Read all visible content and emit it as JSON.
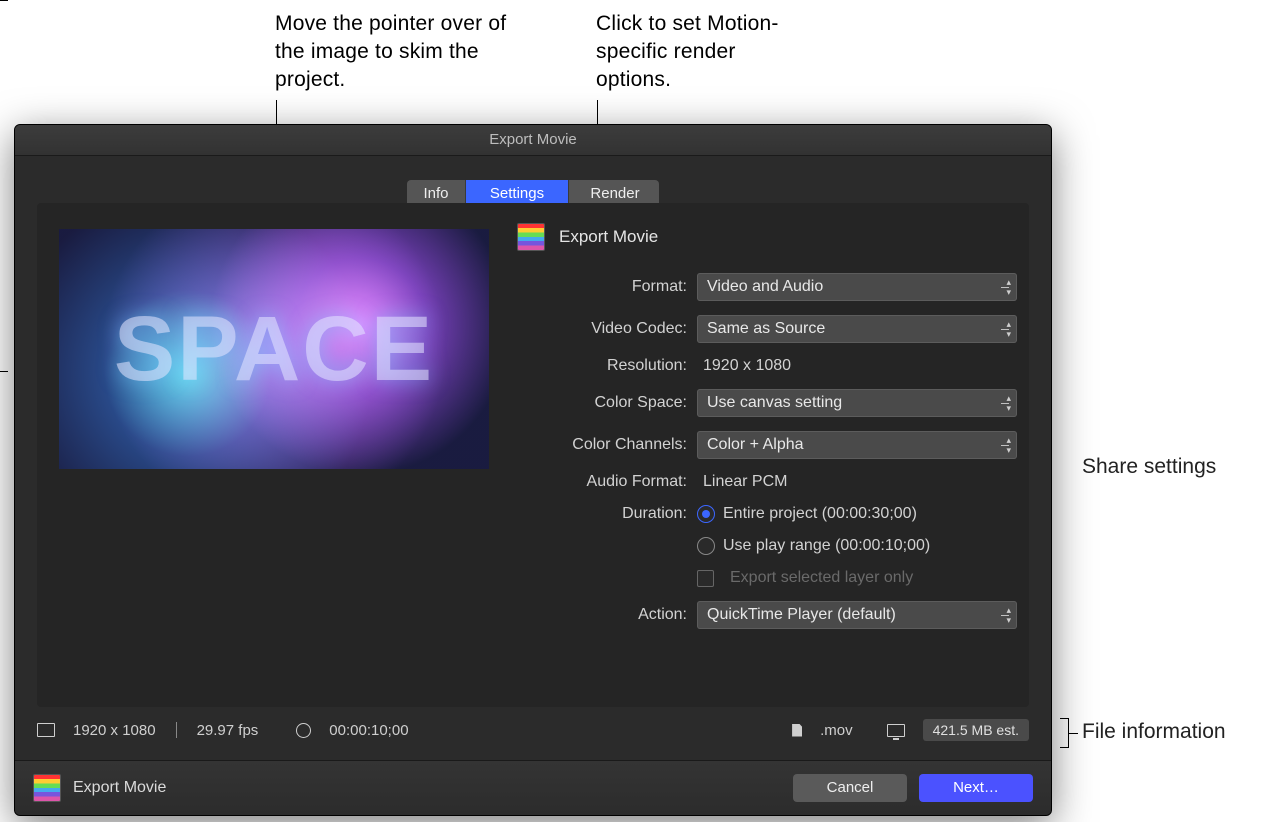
{
  "callouts": {
    "skim": "Move the pointer over of the image to skim the project.",
    "render": "Click to set Motion-specific render options.",
    "share": "Share settings",
    "fileinfo": "File information"
  },
  "dialog": {
    "title": "Export Movie",
    "tabs": {
      "info": "Info",
      "settings": "Settings",
      "render": "Render"
    },
    "header": "Export Movie",
    "preview_text": "SPACE",
    "settings": {
      "format": {
        "label": "Format:",
        "value": "Video and Audio"
      },
      "codec": {
        "label": "Video Codec:",
        "value": "Same as Source"
      },
      "resolution": {
        "label": "Resolution:",
        "value": "1920 x 1080"
      },
      "colorspace": {
        "label": "Color Space:",
        "value": "Use canvas setting"
      },
      "channels": {
        "label": "Color Channels:",
        "value": "Color + Alpha"
      },
      "audio": {
        "label": "Audio Format:",
        "value": "Linear PCM"
      },
      "duration": {
        "label": "Duration:",
        "opt1": "Entire project (00:00:30;00)",
        "opt2": "Use play range (00:00:10;00)"
      },
      "export_layer": "Export selected layer only",
      "action": {
        "label": "Action:",
        "value": "QuickTime Player (default)"
      }
    },
    "infobar": {
      "dims": "1920 x 1080",
      "fps": "29.97 fps",
      "duration": "00:00:10;00",
      "ext": ".mov",
      "size": "421.5 MB est."
    },
    "footer": {
      "title": "Export Movie",
      "cancel": "Cancel",
      "next": "Next…"
    }
  }
}
